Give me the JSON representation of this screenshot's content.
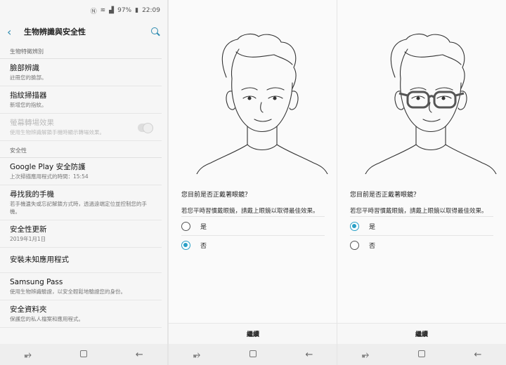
{
  "status_bar": {
    "battery": "97%",
    "time": "22:09"
  },
  "settings": {
    "title": "生物辨識與安全性",
    "section_biometrics": "生物特徵辨別",
    "face": {
      "title": "臉部辨識",
      "sub": "註冊您的臉部。"
    },
    "fingerprint": {
      "title": "指紋掃描器",
      "sub": "新增您的指紋。"
    },
    "screen_transition": {
      "title": "螢幕轉場效果",
      "sub": "使用生物辨識解鎖手機時顯示轉場效果。"
    },
    "section_security": "安全性",
    "play_protect": {
      "title": "Google Play 安全防護",
      "sub": "上次掃描應用程式的時間：15:54"
    },
    "find_my_mobile": {
      "title": "尋找我的手機",
      "sub": "若手機遺失或忘記解鎖方式時，透過遠端定位並控制您的手機。"
    },
    "security_update": {
      "title": "安全性更新",
      "sub": "2019年1月1日"
    },
    "unknown_apps": {
      "title": "安裝未知應用程式"
    },
    "samsung_pass": {
      "title": "Samsung Pass",
      "sub": "使用生物辨識驗證，以安全輕鬆地驗證您的身份。"
    },
    "secure_folder": {
      "title": "安全資料夾",
      "sub": "保護您的私人檔案和應用程式。"
    }
  },
  "glasses_no": {
    "question": "您目前是否正戴著眼鏡？",
    "note": "若您平時習慣戴眼鏡，請戴上眼鏡以取得最佳效果。",
    "option_yes": "是",
    "option_no": "否",
    "selected": "no",
    "continue": "繼續"
  },
  "glasses_yes": {
    "question": "您目前是否正戴著眼鏡？",
    "note": "若您平時習慣戴眼鏡，請戴上眼鏡以取得最佳效果。",
    "option_yes": "是",
    "option_no": "否",
    "selected": "yes",
    "continue": "繼續"
  },
  "colors": {
    "accent": "#2aa0c6",
    "link": "#2d8bb0"
  },
  "icons": [
    "nfc-icon",
    "wifi-icon",
    "signal-icon",
    "battery-icon",
    "back-arrow-icon",
    "search-icon",
    "recent-apps-icon",
    "home-icon",
    "back-nav-icon"
  ]
}
